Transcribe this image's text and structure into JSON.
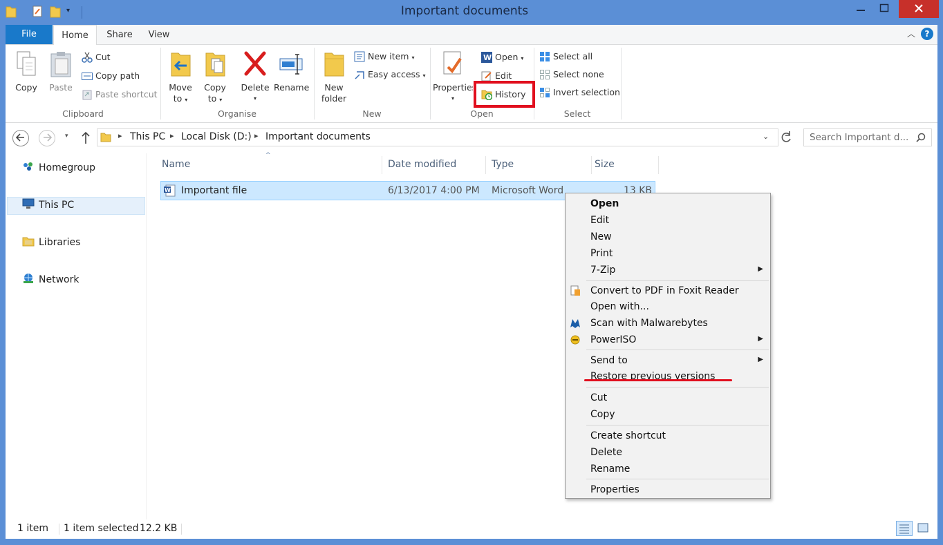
{
  "window": {
    "title": "Important documents"
  },
  "ribbon": {
    "tabs": {
      "file": "File",
      "home": "Home",
      "share": "Share",
      "view": "View"
    },
    "clipboard": {
      "label": "Clipboard",
      "copy": "Copy",
      "paste": "Paste",
      "cut": "Cut",
      "copy_path": "Copy path",
      "paste_shortcut": "Paste shortcut"
    },
    "organise": {
      "label": "Organise",
      "move_to_line1": "Move",
      "move_to_line2": "to",
      "copy_to_line1": "Copy",
      "copy_to_line2": "to",
      "delete": "Delete",
      "rename": "Rename"
    },
    "new": {
      "label": "New",
      "new_folder_line1": "New",
      "new_folder_line2": "folder",
      "new_item": "New item",
      "easy_access": "Easy access"
    },
    "open": {
      "label": "Open",
      "properties": "Properties",
      "open": "Open",
      "edit": "Edit",
      "history": "History"
    },
    "select": {
      "label": "Select",
      "select_all": "Select all",
      "select_none": "Select none",
      "invert_selection": "Invert selection"
    }
  },
  "address": {
    "crumbs": [
      "This PC",
      "Local Disk (D:)",
      "Important documents"
    ],
    "search_placeholder": "Search Important d..."
  },
  "navpane": {
    "items": [
      "Homegroup",
      "This PC",
      "Libraries",
      "Network"
    ]
  },
  "filelist": {
    "columns": [
      "Name",
      "Date modified",
      "Type",
      "Size"
    ],
    "rows": [
      {
        "name": "Important file",
        "date": "6/13/2017 4:00 PM",
        "type": "Microsoft Word D...",
        "size": "13 KB"
      }
    ]
  },
  "status": {
    "count": "1 item",
    "selected": "1 item selected",
    "size": "12.2 KB"
  },
  "context_menu": {
    "items": [
      "Open",
      "Edit",
      "New",
      "Print",
      "7-Zip",
      "Convert to PDF in Foxit Reader",
      "Open with...",
      "Scan with Malwarebytes",
      "PowerISO",
      "Send to",
      "Restore previous versions",
      "Cut",
      "Copy",
      "Create shortcut",
      "Delete",
      "Rename",
      "Properties"
    ]
  },
  "colors": {
    "frame": "#5b8fd6",
    "file_tab": "#1979ca",
    "selection": "#cce8ff",
    "annotation_red": "#e10f1e",
    "close": "#c7302a"
  }
}
